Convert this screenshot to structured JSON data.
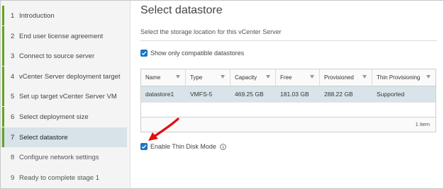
{
  "sidebar": {
    "steps": [
      {
        "num": "1",
        "label": "Introduction",
        "state": "done"
      },
      {
        "num": "2",
        "label": "End user license agreement",
        "state": "done"
      },
      {
        "num": "3",
        "label": "Connect to source server",
        "state": "done"
      },
      {
        "num": "4",
        "label": "vCenter Server deployment target",
        "state": "done"
      },
      {
        "num": "5",
        "label": "Set up target vCenter Server VM",
        "state": "done"
      },
      {
        "num": "6",
        "label": "Select deployment size",
        "state": "done"
      },
      {
        "num": "7",
        "label": "Select datastore",
        "state": "active"
      },
      {
        "num": "8",
        "label": "Configure network settings",
        "state": "pending"
      },
      {
        "num": "9",
        "label": "Ready to complete stage 1",
        "state": "pending"
      }
    ]
  },
  "main": {
    "title": "Select datastore",
    "subtitle": "Select the storage location for this vCenter Server",
    "compatible_label": "Show only compatible datastores",
    "compatible_checked": true,
    "thin_label": "Enable Thin Disk Mode",
    "thin_checked": true
  },
  "table": {
    "columns": [
      "Name",
      "Type",
      "Capacity",
      "Free",
      "Provisioned",
      "Thin Provisioning"
    ],
    "rows": [
      [
        "datastore1",
        "VMFS-5",
        "469.25 GB",
        "181.03 GB",
        "288.22 GB",
        "Supported"
      ]
    ],
    "footer": "1  item"
  },
  "colors": {
    "accent": "#1b74c4",
    "done_bar": "#62a420",
    "selected_row": "#d9e4ea",
    "annotation_arrow": "#e01010"
  },
  "icons": {
    "checkbox": "checkmark-icon",
    "filter": "filter-icon",
    "info": "info-icon",
    "annotation": "red-arrow-icon"
  }
}
